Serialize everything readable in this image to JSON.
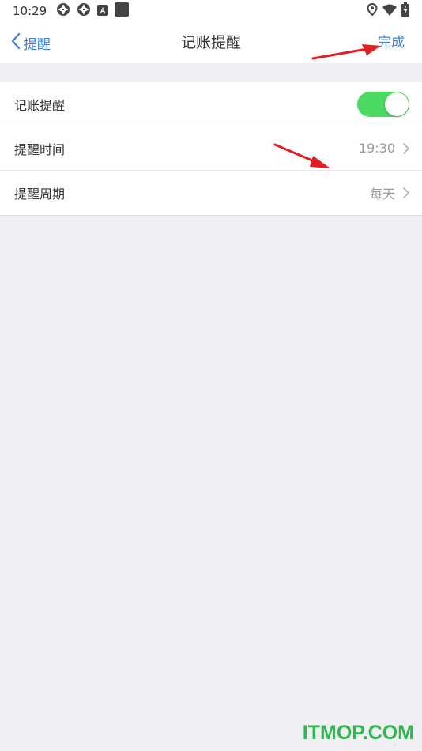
{
  "status_bar": {
    "time": "10:29",
    "left_icons": [
      "aperture-icon",
      "aperture-icon",
      "a-app-icon",
      "square-app-icon"
    ],
    "right_icons": [
      "location-icon",
      "wifi-icon",
      "battery-charging-icon"
    ]
  },
  "nav": {
    "back_label": "提醒",
    "title": "记账提醒",
    "done_label": "完成"
  },
  "settings": {
    "rows": [
      {
        "label": "记账提醒",
        "type": "toggle",
        "on": true
      },
      {
        "label": "提醒时间",
        "value": "19:30"
      },
      {
        "label": "提醒周期",
        "value": "每天"
      }
    ]
  },
  "colors": {
    "accent": "#3b82e0",
    "toggle_on": "#4cd964",
    "background": "#efeff4",
    "annotation_arrow": "#e02020"
  },
  "watermark": "ITMOP.COM"
}
